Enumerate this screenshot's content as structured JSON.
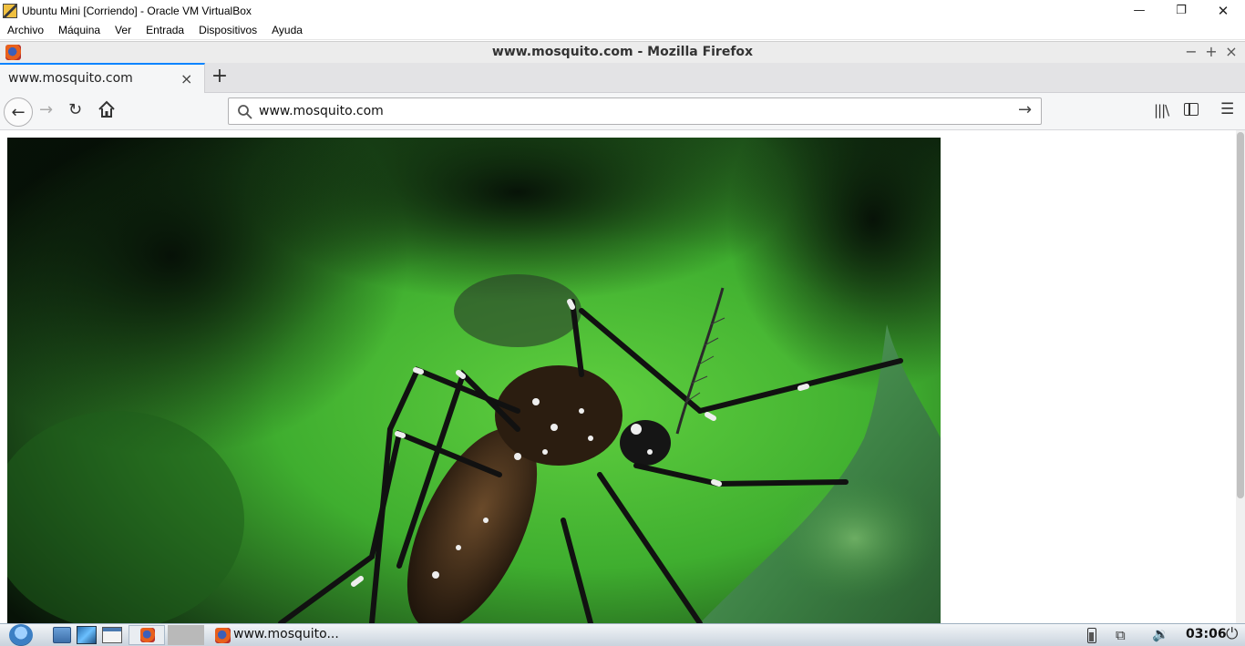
{
  "vbox": {
    "title": "Ubuntu Mini [Corriendo] - Oracle VM VirtualBox",
    "menu": [
      "Archivo",
      "Máquina",
      "Ver",
      "Entrada",
      "Dispositivos",
      "Ayuda"
    ],
    "controls": {
      "minimize": "—",
      "restore": "❐",
      "close": "✕"
    }
  },
  "firefox": {
    "window_title": "www.mosquito.com - Mozilla Firefox",
    "window_controls": {
      "minimize": "−",
      "maximize": "+",
      "close": "×"
    },
    "tab": {
      "title": "www.mosquito.com",
      "close": "×"
    },
    "new_tab": "+",
    "nav": {
      "back": "←",
      "forward": "→",
      "reload": "↻",
      "go": "→",
      "library": "|||\\",
      "menu": "☰"
    },
    "url": "www.mosquito.com"
  },
  "page": {
    "image_subject": "mosquito-photo"
  },
  "taskbar": {
    "task_label": "www.mosquito...",
    "clock": "03:06",
    "icons": [
      "start-menu-icon",
      "file-manager-icon",
      "desktop-icon",
      "window-icon",
      "firefox-icon",
      "battery-icon",
      "network-icon",
      "volume-icon",
      "power-icon"
    ]
  },
  "colors": {
    "tab_accent": "#0a84ff",
    "leaf_green": "#4fbf3a",
    "background_dark": "#0a1a0c"
  }
}
